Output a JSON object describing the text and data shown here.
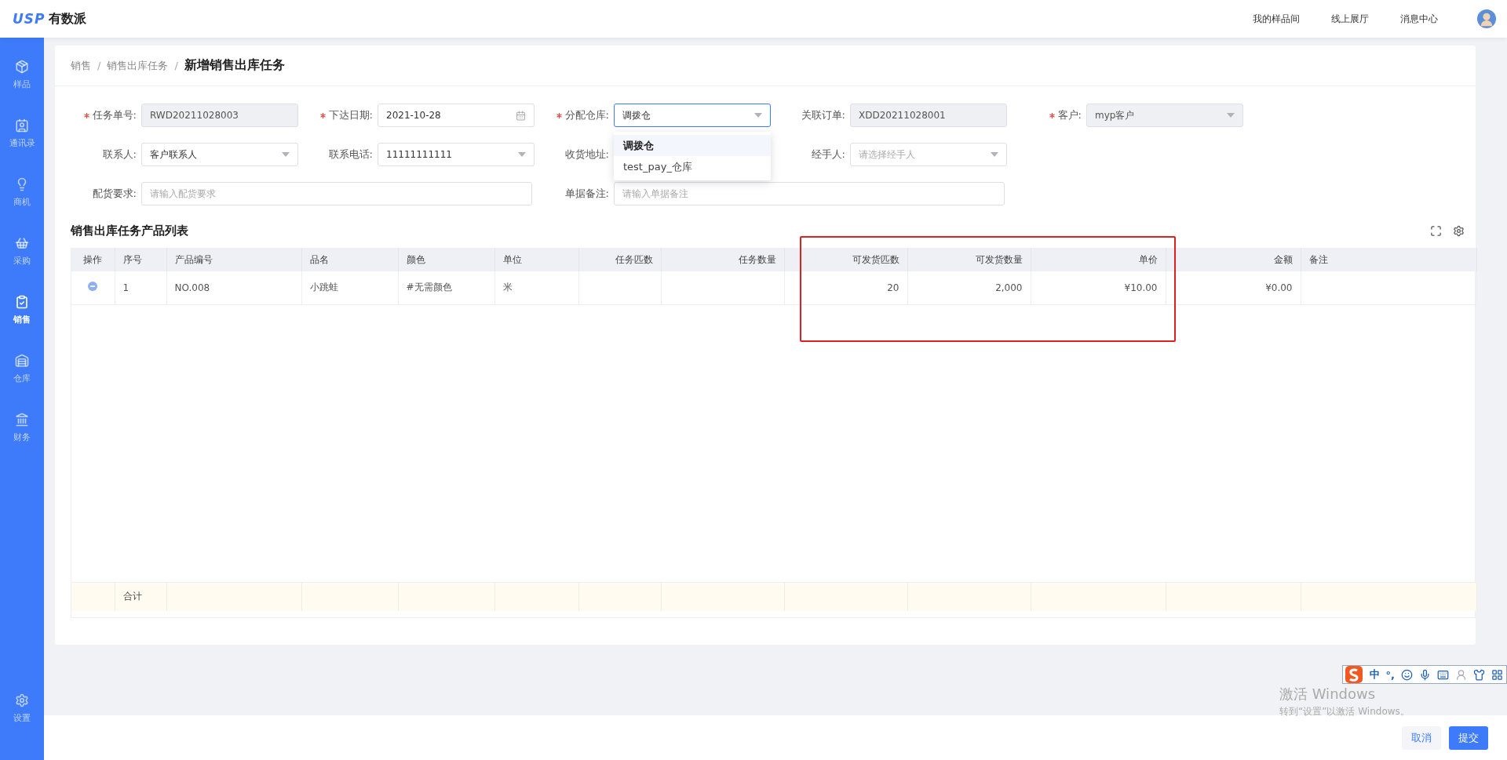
{
  "header": {
    "logo": {
      "mark": "USP",
      "name": "有数派"
    },
    "links": [
      "我的样品间",
      "线上展厅",
      "消息中心"
    ]
  },
  "sidebar": {
    "items": [
      {
        "label": "样品",
        "selected": false
      },
      {
        "label": "通讯录",
        "selected": false
      },
      {
        "label": "商机",
        "selected": false
      },
      {
        "label": "采购",
        "selected": false
      },
      {
        "label": "销售",
        "selected": true
      },
      {
        "label": "仓库",
        "selected": false
      },
      {
        "label": "财务",
        "selected": false
      }
    ],
    "footer": {
      "label": "设置",
      "selected": false
    }
  },
  "breadcrumb": {
    "separator": "/",
    "items": [
      "销售",
      "销售出库任务",
      "新增销售出库任务"
    ]
  },
  "form": {
    "fields": [
      {
        "label": "任务单号:",
        "required": true,
        "kind": "text",
        "value": "RWD20211028003",
        "disabled": true
      },
      {
        "label": "下达日期:",
        "required": true,
        "kind": "date",
        "value": "2021-10-28",
        "disabled": false
      },
      {
        "label": "分配仓库:",
        "required": true,
        "kind": "select",
        "value": "调拨仓",
        "disabled": false,
        "expanded": true,
        "options": [
          {
            "label": "调拨仓",
            "selected": true
          },
          {
            "label": "test_pay_仓库",
            "selected": false
          }
        ]
      },
      {
        "label": "关联订单:",
        "required": false,
        "kind": "text",
        "value": "XDD20211028001",
        "disabled": true
      },
      {
        "label": "客户:",
        "required": true,
        "kind": "select",
        "value": "myp客户",
        "disabled": true
      },
      {
        "label": "联系人:",
        "required": false,
        "kind": "select",
        "value": "客户联系人",
        "disabled": false
      },
      {
        "label": "联系电话:",
        "required": false,
        "kind": "select",
        "value": "11111111111",
        "disabled": false
      },
      {
        "label": "收货地址:",
        "required": false,
        "kind": "text"
      },
      {
        "label": "经手人:",
        "required": false,
        "kind": "select",
        "placeholder": "请选择经手人",
        "disabled": false
      },
      {
        "label": "配货要求:",
        "required": false,
        "kind": "wide",
        "placeholder": "请输入配货要求",
        "disabled": false
      },
      {
        "label": "单据备注:",
        "required": false,
        "kind": "wide",
        "placeholder": "请输入单据备注",
        "disabled": false
      }
    ]
  },
  "table": {
    "title": "销售出库任务产品列表",
    "columns": [
      "操作",
      "序号",
      "产品编号",
      "品名",
      "颜色",
      "单位",
      "任务匹数",
      "任务数量",
      "可发货匹数",
      "可发货数量",
      "单价",
      "金额",
      "备注"
    ],
    "rows": [
      {
        "kind": "removable",
        "cells": [
          "",
          "1",
          "NO.008",
          "小跳蛙",
          "#无需颜色",
          "米",
          "",
          "",
          "20",
          "2,000",
          "¥10.00",
          "¥0.00",
          ""
        ]
      }
    ],
    "summary": {
      "cells": [
        "",
        "合计",
        "",
        "",
        "",
        "",
        "",
        "",
        "",
        "",
        "",
        "",
        ""
      ]
    }
  },
  "annotation": {
    "kind": "frame"
  },
  "ime_toolbar": {
    "mode": "中",
    "punctuation": "°,"
  },
  "windows_notice": {
    "title": "激活 Windows",
    "subtitle": "转到“设置”以激活 Windows。"
  },
  "footer": {
    "buttons": [
      {
        "label": "取消",
        "kind": "default"
      },
      {
        "label": "提交",
        "kind": "primary"
      }
    ]
  }
}
